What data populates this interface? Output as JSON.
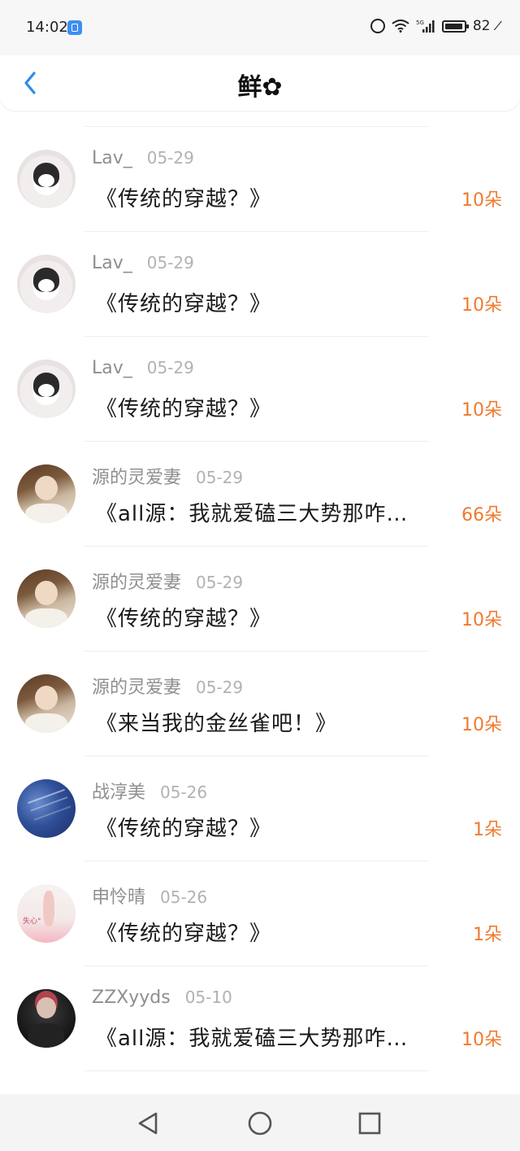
{
  "status_bar": {
    "time": "14:02",
    "network": "5G",
    "battery": "82"
  },
  "header": {
    "title": "鲜✿"
  },
  "records": [
    {
      "avatar": "kuromi",
      "name": "Lav_",
      "date": "05-29",
      "title": "《传统的穿越？》",
      "count": "10朵"
    },
    {
      "avatar": "kuromi",
      "name": "Lav_",
      "date": "05-29",
      "title": "《传统的穿越？》",
      "count": "10朵"
    },
    {
      "avatar": "kuromi",
      "name": "Lav_",
      "date": "05-29",
      "title": "《传统的穿越？》",
      "count": "10朵"
    },
    {
      "avatar": "boy",
      "name": "源的灵爱妻",
      "date": "05-29",
      "title": "《all源：我就爱磕三大势那咋…",
      "count": "66朵"
    },
    {
      "avatar": "boy",
      "name": "源的灵爱妻",
      "date": "05-29",
      "title": "《传统的穿越？》",
      "count": "10朵"
    },
    {
      "avatar": "boy",
      "name": "源的灵爱妻",
      "date": "05-29",
      "title": "《来当我的金丝雀吧！》",
      "count": "10朵"
    },
    {
      "avatar": "sky",
      "name": "战淳美",
      "date": "05-26",
      "title": "《传统的穿越？》",
      "count": "1朵"
    },
    {
      "avatar": "pink",
      "name": "申怜晴",
      "date": "05-26",
      "title": "《传统的穿越？》",
      "count": "1朵",
      "avatar_tag": "失心°"
    },
    {
      "avatar": "dark",
      "name": "ZZXyyds",
      "date": "05-10",
      "title": "《all源：我就爱磕三大势那咋…",
      "count": "10朵"
    }
  ],
  "colors": {
    "accent_blue": "#2f8bea",
    "count_orange": "#f07a2e"
  },
  "icons": {
    "back": "chevron-left-icon",
    "nav_back": "triangle-back-icon",
    "nav_home": "circle-home-icon",
    "nav_recents": "square-recents-icon"
  }
}
